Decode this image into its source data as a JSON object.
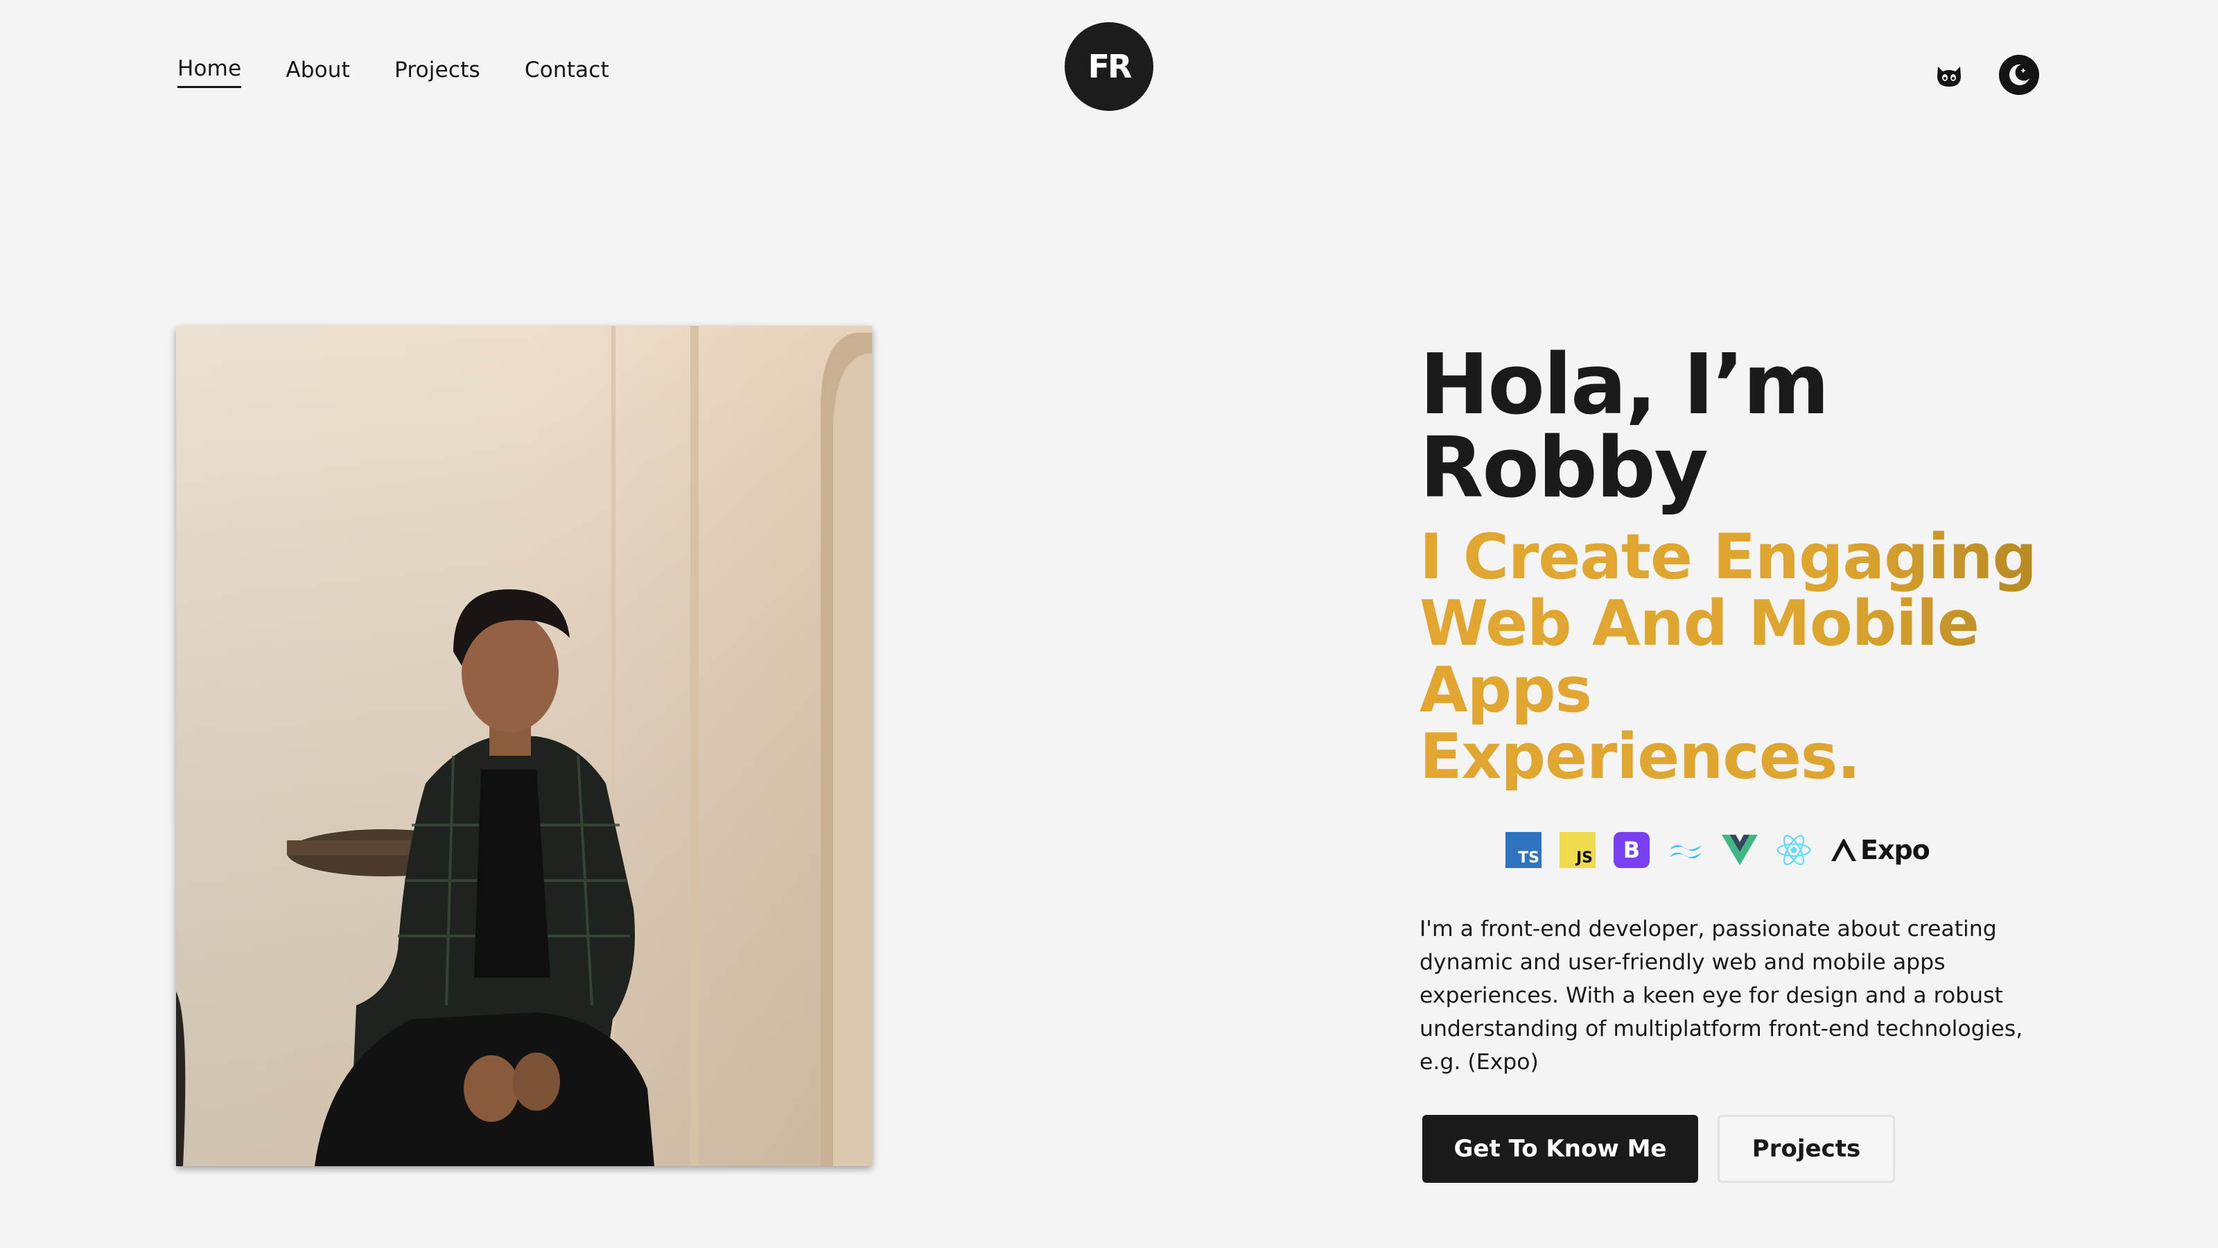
{
  "nav": {
    "items": [
      {
        "label": "Home",
        "active": true
      },
      {
        "label": "About"
      },
      {
        "label": "Projects"
      },
      {
        "label": "Contact"
      }
    ]
  },
  "logo": {
    "text": "FR",
    "color": "#1c1c1c"
  },
  "header_icons": {
    "github": "github-cat-icon",
    "theme": "dark-mode-moon-icon"
  },
  "hero": {
    "title_line1": "Hola, I’m",
    "title_line2": "Robby",
    "subtitle_lines": [
      "I Create Engaging",
      "Web And Mobile",
      "Apps",
      "Experiences."
    ],
    "accent_color": "#e2a630",
    "tech_stack": [
      {
        "name": "typescript-icon",
        "label": "TS"
      },
      {
        "name": "javascript-icon",
        "label": "JS"
      },
      {
        "name": "bootstrap-icon",
        "label": "B"
      },
      {
        "name": "tailwind-icon"
      },
      {
        "name": "vue-icon"
      },
      {
        "name": "react-icon"
      },
      {
        "name": "expo-icon",
        "label": "Expo"
      }
    ],
    "description": "I'm a front-end developer, passionate about creating dynamic and user-friendly web and mobile apps experiences. With a keen eye for design and a robust understanding of multiplatform front-end technologies, e.g. (Expo)",
    "primary_button": "Get To Know Me",
    "secondary_button": "Projects"
  }
}
